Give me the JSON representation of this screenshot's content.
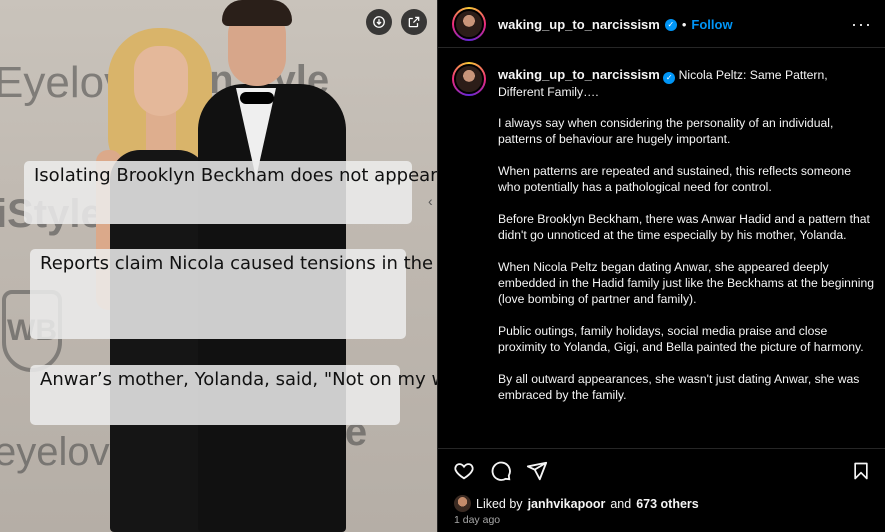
{
  "photo": {
    "brand_texts": [
      "Eyelove",
      "InStyle",
      "iStyle",
      "eyelove",
      "InStyle"
    ],
    "wb_logo": "WB",
    "captions": [
      "Isolating Brooklyn Beckham does not appear to be Nicola Peltz’s first rodeo…",
      "Reports claim Nicola caused tensions in the Hadid household after Anwar stopped talking to his family while he was dating Peltz.",
      "Anwar’s mother, Yolanda, said, \"Not on my watch.\""
    ],
    "icons": {
      "download": "download-icon",
      "share": "open-external-icon"
    }
  },
  "header": {
    "username": "waking_up_to_narcissism",
    "separator": "•",
    "follow_label": "Follow",
    "more_label": "···"
  },
  "caption": {
    "username": "waking_up_to_narcissism",
    "title": "Nicola Peltz: Same Pattern, Different Family….",
    "paragraphs": [
      "I always say when considering the personality of an individual, patterns of behaviour are hugely important.",
      "When patterns are repeated and sustained, this reflects someone who potentially has a pathological need for control.",
      "Before Brooklyn Beckham, there was Anwar Hadid and a pattern that didn't go unnoticed at the time especially by his mother, Yolanda.",
      "When Nicola Peltz began dating Anwar, she appeared deeply embedded in the Hadid family just like the Beckhams at the beginning (love bombing of partner and family).",
      "Public outings, family holidays, social media praise and close proximity to Yolanda, Gigi, and Bella painted the picture of harmony.",
      "By all outward appearances, she wasn't just dating Anwar, she was embraced by the family."
    ]
  },
  "actions": {
    "like": "heart-icon",
    "comment": "comment-icon",
    "share": "send-icon",
    "save": "bookmark-icon"
  },
  "likes": {
    "prefix": "Liked by",
    "user": "janhvikapoor",
    "connector": "and",
    "others": "673 others"
  },
  "timestamp": "1 day ago",
  "colors": {
    "accent": "#0095f6",
    "background": "#000000",
    "muted": "#a8a8a8"
  }
}
